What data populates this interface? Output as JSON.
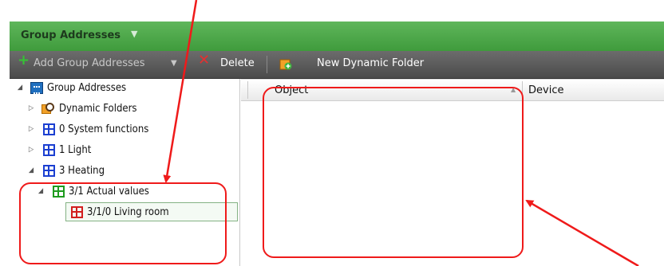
{
  "window": {
    "title": "Group Addresses"
  },
  "toolbar": {
    "add_label": "Add Group Addresses",
    "delete_label": "Delete",
    "new_dynamic_folder_label": "New Dynamic Folder"
  },
  "tree": {
    "items": [
      {
        "label": "Group Addresses",
        "icon": "group-addresses-icon",
        "expand": "expanded"
      },
      {
        "label": "Dynamic Folders",
        "icon": "dynamic-folder-icon",
        "expand": "collapsed"
      },
      {
        "label": "0 System functions",
        "icon": "group-icon",
        "expand": "collapsed"
      },
      {
        "label": "1 Light",
        "icon": "group-icon",
        "expand": "collapsed"
      },
      {
        "label": "3 Heating",
        "icon": "group-icon",
        "expand": "expanded"
      },
      {
        "label": "3/1 Actual values",
        "icon": "middle-group-icon",
        "expand": "expanded"
      },
      {
        "label": "3/1/0 Living room",
        "icon": "group-address-icon",
        "selected": true
      }
    ]
  },
  "table": {
    "columns": [
      "Object",
      "Device"
    ]
  },
  "colors": {
    "annotation": "#ef1a1a",
    "titlebar": "#4aa947",
    "blue_icon": "#1b3fd1",
    "green_icon": "#1e9b1e",
    "red_icon": "#d21e1e"
  }
}
